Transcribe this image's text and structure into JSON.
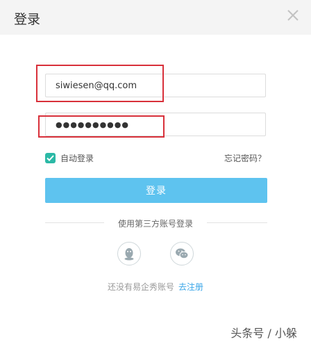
{
  "dialog": {
    "title": "登录"
  },
  "form": {
    "account_value": "siwiesen@qq.com",
    "password_value": "●●●●●●●●●●",
    "auto_login_label": "自动登录",
    "forgot_label": "忘记密码？",
    "login_button_label": "登录"
  },
  "third_party": {
    "label": "使用第三方账号登录",
    "icons": [
      "qq-icon",
      "wechat-icon"
    ]
  },
  "register": {
    "prompt": "还没有易企秀账号",
    "link_label": "去注册"
  },
  "watermark": "头条号 / 小躲",
  "colors": {
    "accent": "#5ec3ef",
    "checkbox": "#2bb9a6",
    "highlight": "#d8303a",
    "link": "#3aa6e8"
  }
}
